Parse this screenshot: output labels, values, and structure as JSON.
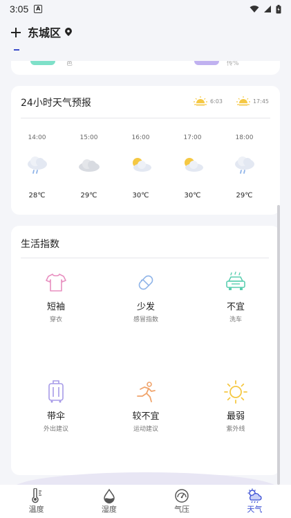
{
  "status_bar": {
    "time": "3:05",
    "app_badge": "A"
  },
  "header": {
    "city": "东城区"
  },
  "top_card": {
    "left_text": "邑",
    "right_text": "传%"
  },
  "forecast": {
    "title": "24小时天气预报",
    "sunrise": "6:03",
    "sunset": "17:45",
    "hours": [
      {
        "time": "14:00",
        "icon": "cloud-rain-icon",
        "temp": "28℃"
      },
      {
        "time": "15:00",
        "icon": "cloud-icon",
        "temp": "29℃"
      },
      {
        "time": "16:00",
        "icon": "partly-cloudy-icon",
        "temp": "30℃"
      },
      {
        "time": "17:00",
        "icon": "partly-cloudy-icon",
        "temp": "30℃"
      },
      {
        "time": "18:00",
        "icon": "cloud-rain-icon",
        "temp": "29℃"
      }
    ]
  },
  "life": {
    "title": "生活指数",
    "items": [
      {
        "value": "短袖",
        "name": "穿衣",
        "icon": "tshirt-icon"
      },
      {
        "value": "少发",
        "name": "感冒指数",
        "icon": "pill-icon"
      },
      {
        "value": "不宜",
        "name": "洗车",
        "icon": "car-wash-icon"
      },
      {
        "value": "带伞",
        "name": "外出建议",
        "icon": "luggage-icon"
      },
      {
        "value": "较不宜",
        "name": "运动建议",
        "icon": "running-icon"
      },
      {
        "value": "最弱",
        "name": "紫外线",
        "icon": "sun-icon"
      }
    ]
  },
  "nav": [
    {
      "label": "温度",
      "icon": "thermometer-icon",
      "active": false
    },
    {
      "label": "湿度",
      "icon": "humidity-icon",
      "active": false
    },
    {
      "label": "气压",
      "icon": "gauge-icon",
      "active": false
    },
    {
      "label": "天气",
      "icon": "weather-icon",
      "active": true
    }
  ],
  "colors": {
    "accent": "#3b4fd4",
    "teal": "#5ccfb0",
    "purple": "#a79be8",
    "pink": "#e88fc0",
    "orange": "#f0a36a",
    "yellow": "#f5c843"
  }
}
